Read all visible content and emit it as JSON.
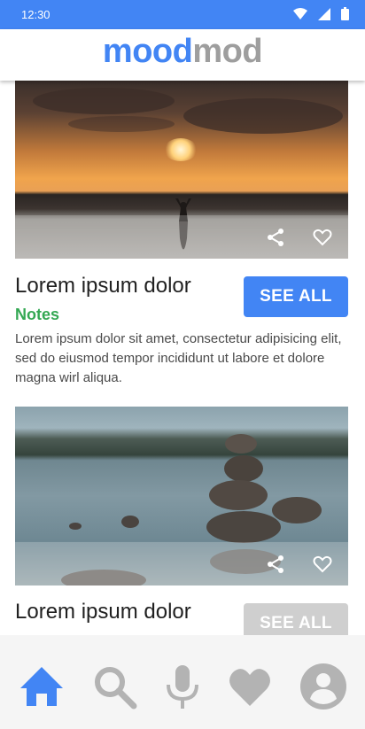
{
  "status_bar": {
    "time": "12:30"
  },
  "app": {
    "logo_part1": "mood",
    "logo_part2": "mod"
  },
  "cards": [
    {
      "title": "Lorem ipsum dolor",
      "subtitle": "Notes",
      "description": "Lorem ipsum dolor sit amet, consectetur adipisicing elit, sed do eiusmod tempor incididunt ut labore et dolore magna wirl aliqua.",
      "button_label": "SEE ALL",
      "image": "sunset-meditation-photo"
    },
    {
      "title": "Lorem ipsum dolor",
      "button_label": "SEE ALL",
      "image": "lake-stacked-stones-photo"
    }
  ],
  "bottom_nav": [
    "home-icon",
    "search-icon",
    "microphone-icon",
    "heart-icon",
    "profile-icon"
  ],
  "colors": {
    "primary": "#4285f4",
    "accent_green": "#34a853",
    "inactive_gray": "#9e9e9e",
    "nav_background": "#f5f5f5"
  }
}
